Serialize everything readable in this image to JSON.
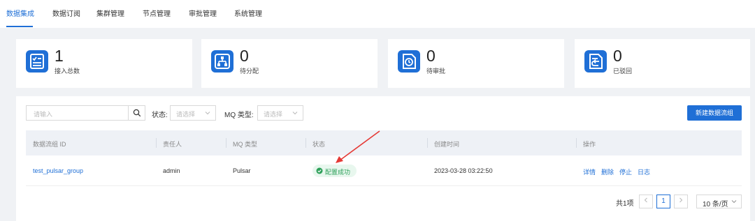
{
  "nav": {
    "tabs": [
      "数据集成",
      "数据订阅",
      "集群管理",
      "节点管理",
      "审批管理",
      "系统管理"
    ]
  },
  "stats": [
    {
      "count": "1",
      "label": "接入总数",
      "icon": "list-check-icon"
    },
    {
      "count": "0",
      "label": "待分配",
      "icon": "org-chart-icon"
    },
    {
      "count": "0",
      "label": "待审批",
      "icon": "clock-document-icon"
    },
    {
      "count": "0",
      "label": "已驳回",
      "icon": "return-document-icon"
    }
  ],
  "filters": {
    "search_placeholder": "请输入",
    "status_label": "状态:",
    "status_placeholder": "请选择",
    "mq_label": "MQ 类型:",
    "mq_placeholder": "请选择",
    "new_button": "新建数据流组"
  },
  "table": {
    "headers": [
      "数据流组 ID",
      "责任人",
      "MQ 类型",
      "状态",
      "创建时间",
      "操作"
    ],
    "rows": [
      {
        "id": "test_pulsar_group",
        "owner": "admin",
        "mq": "Pulsar",
        "status": "配置成功",
        "created": "2023-03-28 03:22:50",
        "actions": [
          "详情",
          "删除",
          "停止",
          "日志"
        ]
      }
    ]
  },
  "pagination": {
    "total": "共1项",
    "current": "1",
    "page_size": "10 条/页"
  },
  "colors": {
    "accent": "#1f6fd6",
    "success": "#2ea05a",
    "annotation": "#e53935"
  }
}
